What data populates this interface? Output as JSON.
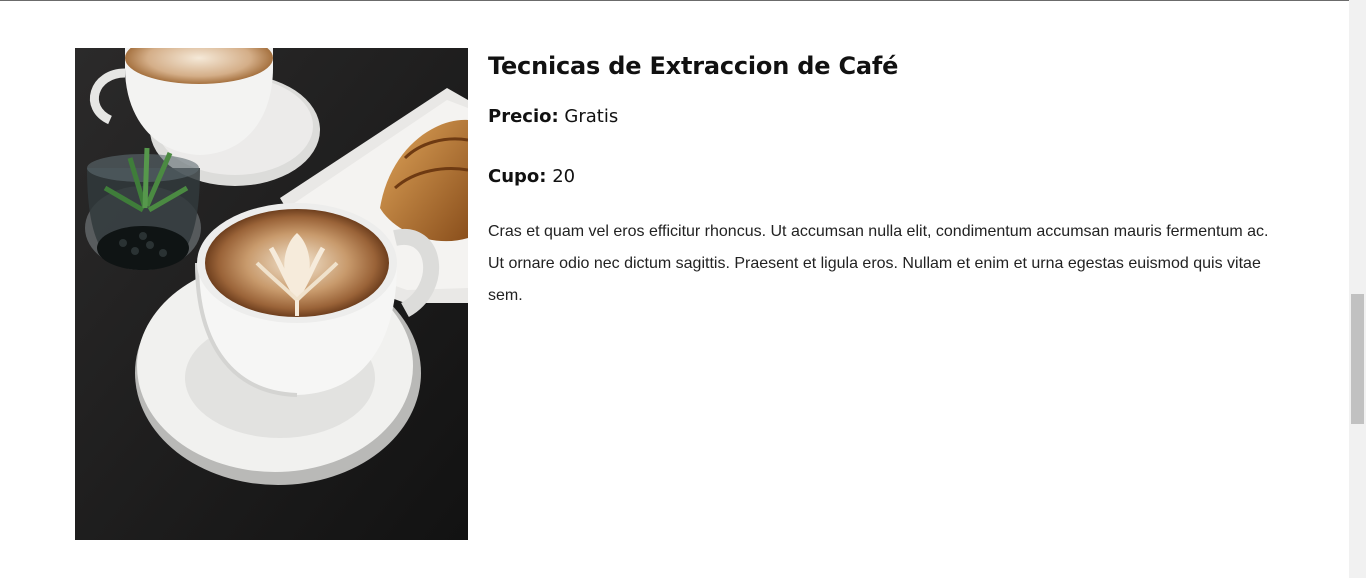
{
  "course": {
    "title": "Tecnicas de Extraccion de Café",
    "price_label": "Precio:",
    "price_value": "Gratis",
    "cupo_label": "Cupo:",
    "cupo_value": "20",
    "description": "Cras et quam vel eros efficitur rhoncus. Ut accumsan nulla elit, condimentum accumsan mauris fermentum ac. Ut ornare odio nec dictum sagittis. Praesent et ligula eros. Nullam et enim et urna egestas euismod quis vitae sem.",
    "image_subject": "latte-art-coffee-cups-photo"
  },
  "scrollbar": {
    "position": 0.51
  }
}
